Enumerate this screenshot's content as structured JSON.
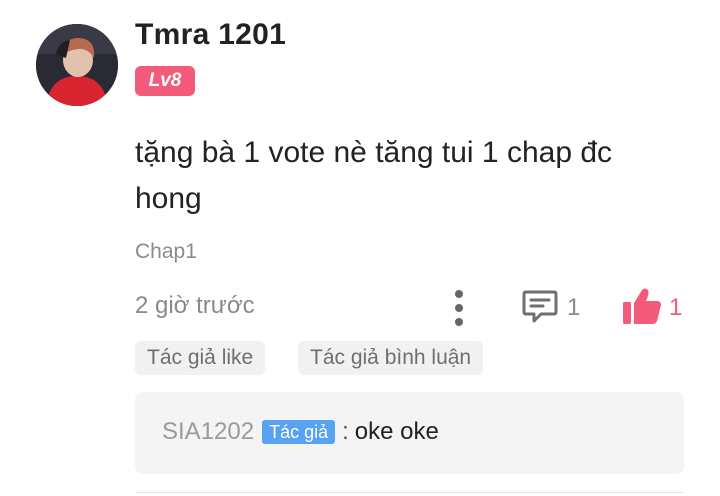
{
  "comment": {
    "username": "Tmra 1201",
    "level": "Lv8",
    "text": "tặng bà 1 vote nè tăng tui 1 chap đc hong",
    "chapter": "Chap1",
    "time": "2 giờ trước",
    "reply_count": "1",
    "like_count": "1",
    "icons": {
      "more": "more-vertical-icon",
      "reply": "comment-bubble-icon",
      "like": "thumbs-up-icon"
    },
    "tags": [
      "Tác giả like",
      "Tác giả bình luận"
    ]
  },
  "reply": {
    "user": "SIA1202",
    "badge": "Tác giả",
    "separator": ":",
    "text": "oke oke"
  },
  "colors": {
    "accent_pink": "#f45b7a",
    "author_badge_blue": "#57a2f2",
    "muted_text": "#8a8a8a"
  }
}
